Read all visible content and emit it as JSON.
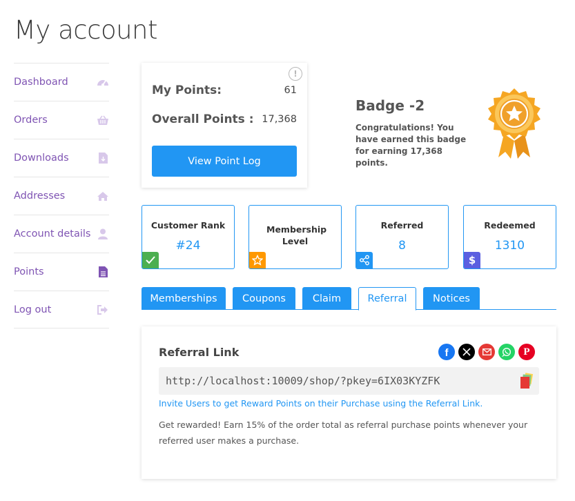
{
  "page": {
    "title": "My account"
  },
  "sidebar": {
    "items": [
      {
        "label": "Dashboard",
        "icon": "dashboard-gauge-icon"
      },
      {
        "label": "Orders",
        "icon": "basket-icon"
      },
      {
        "label": "Downloads",
        "icon": "file-download-icon"
      },
      {
        "label": "Addresses",
        "icon": "home-icon"
      },
      {
        "label": "Account details",
        "icon": "user-icon"
      },
      {
        "label": "Points",
        "icon": "document-icon"
      },
      {
        "label": "Log out",
        "icon": "sign-out-icon"
      }
    ]
  },
  "points": {
    "my_points_label": "My Points:",
    "my_points_value": "61",
    "overall_label": "Overall Points :",
    "overall_value": "17,368",
    "button_label": "View Point Log",
    "info_glyph": "!"
  },
  "badge": {
    "title": "Badge -2",
    "description": "Congratulations! You have earned this badge for earning 17,368 points."
  },
  "stats": [
    {
      "label": "Customer Rank",
      "value": "#24",
      "icon": "check-icon",
      "icon_color": "#4caf50"
    },
    {
      "label": "Membership Level",
      "value": "",
      "icon": "star-icon",
      "icon_color": "#ff9800"
    },
    {
      "label": "Referred",
      "value": "8",
      "icon": "share-icon",
      "icon_color": "#2196f3"
    },
    {
      "label": "Redeemed",
      "value": "1310",
      "icon": "dollar-icon",
      "icon_color": "#5b5fe0"
    }
  ],
  "tabs": [
    {
      "label": "Memberships",
      "active": false
    },
    {
      "label": "Coupons",
      "active": false
    },
    {
      "label": "Claim",
      "active": false
    },
    {
      "label": "Referral",
      "active": true
    },
    {
      "label": "Notices",
      "active": false
    }
  ],
  "referral": {
    "title": "Referral Link",
    "link": "http://localhost:10009/shop/?pkey=6IX03KYZFK",
    "invite_text": "Invite Users to get Reward Points on their Purchase using the Referral Link.",
    "description": "Get rewarded! Earn 15% of the order total as referral purchase points whenever your referred user makes a purchase.",
    "share": [
      {
        "icon": "facebook-icon",
        "color": "#1877f2"
      },
      {
        "icon": "x-icon",
        "color": "#000000"
      },
      {
        "icon": "email-icon",
        "color": "#e53935"
      },
      {
        "icon": "whatsapp-icon",
        "color": "#25d366"
      },
      {
        "icon": "pinterest-icon",
        "color": "#e60023"
      }
    ]
  },
  "colors": {
    "accent": "#2196f3",
    "link": "#7f54b3",
    "badge_gold": "#f5a623"
  }
}
